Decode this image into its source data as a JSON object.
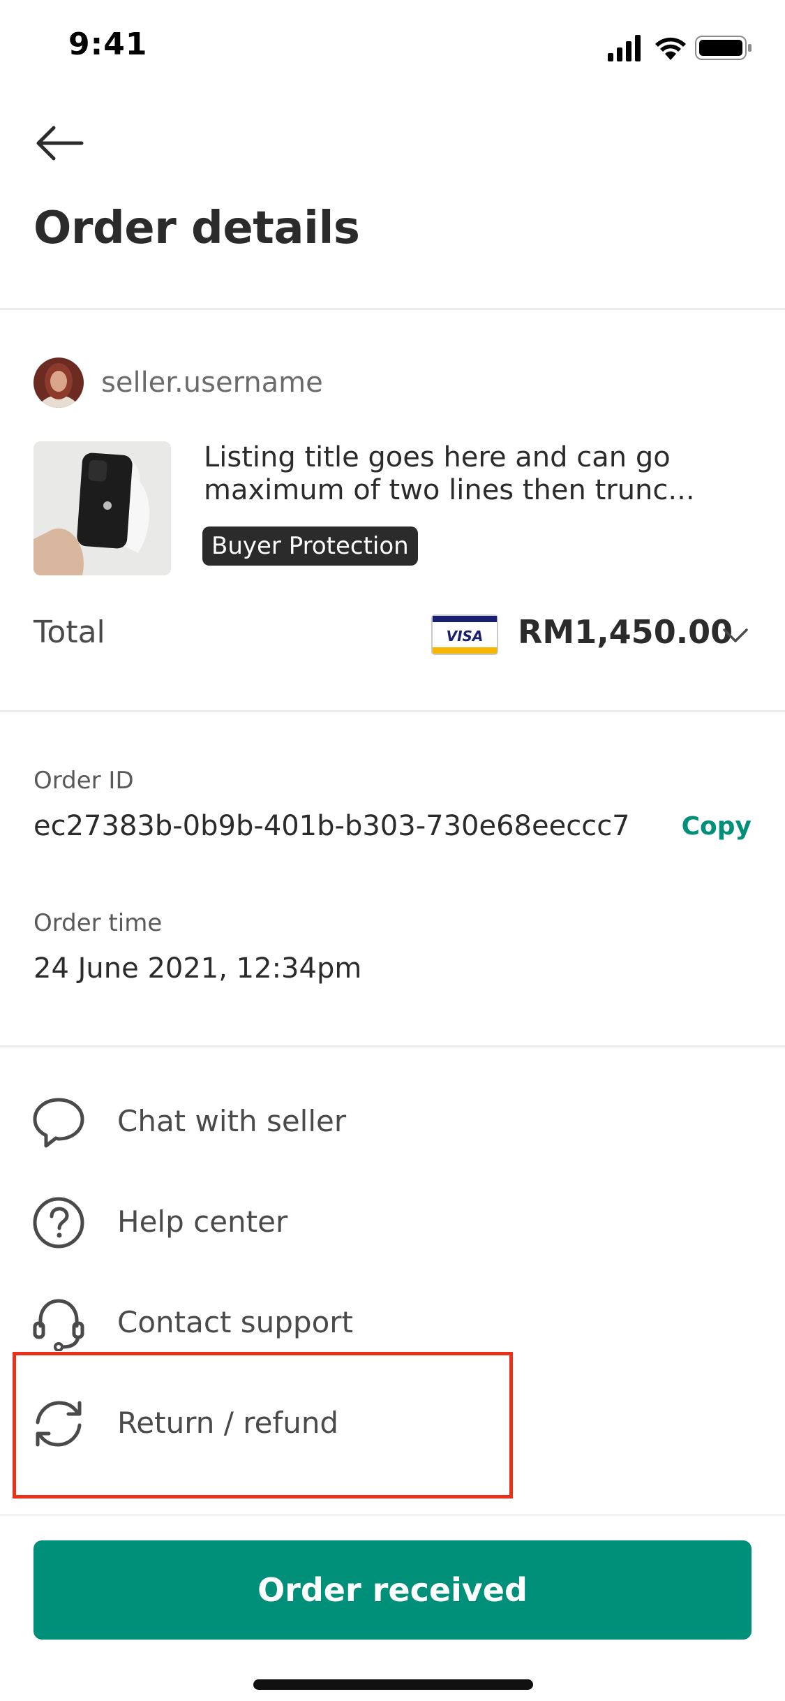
{
  "status_bar": {
    "time": "9:41",
    "icons": [
      "signal-icon",
      "wifi-icon",
      "battery-icon"
    ]
  },
  "header": {
    "back_icon": "arrow-left-icon",
    "title": "Order details"
  },
  "seller": {
    "username": "seller.username",
    "avatar_icon": "avatar"
  },
  "listing": {
    "title": "Listing title goes here and can go maximum of two lines then trunc...",
    "badge": "Buyer Protection"
  },
  "total": {
    "label": "Total",
    "payment_method": "VISA",
    "amount": "RM1,450.00",
    "expand_icon": "chevron-down-icon"
  },
  "order": {
    "id_label": "Order ID",
    "id_value": "ec27383b-0b9b-401b-b303-730e68eeccc7",
    "copy_label": "Copy",
    "time_label": "Order time",
    "time_value": "24 June 2021, 12:34pm"
  },
  "actions": [
    {
      "label": "Chat with seller",
      "icon": "chat-bubble-icon"
    },
    {
      "label": "Help center",
      "icon": "question-circle-icon"
    },
    {
      "label": "Contact support",
      "icon": "headset-icon"
    },
    {
      "label": "Return / refund",
      "icon": "refresh-icon"
    }
  ],
  "footer": {
    "primary_button": "Order received"
  },
  "colors": {
    "accent": "#008f79",
    "highlight": "#e8311a",
    "text": "#2b2b2b"
  }
}
